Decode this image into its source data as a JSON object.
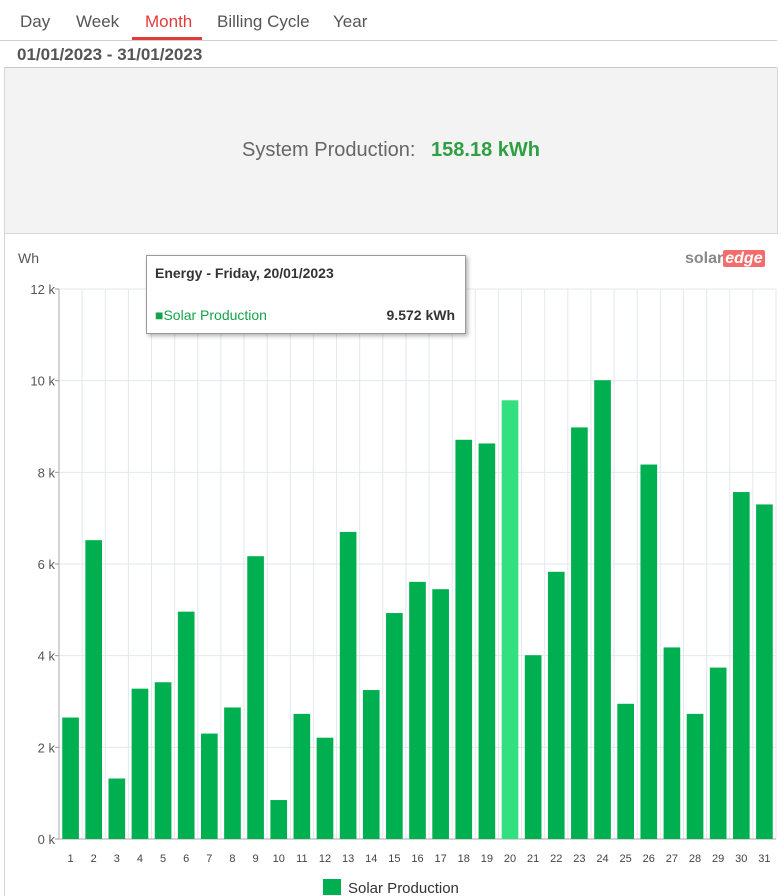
{
  "tabs": [
    {
      "label": "Day"
    },
    {
      "label": "Week"
    },
    {
      "label": "Month"
    },
    {
      "label": "Billing Cycle"
    },
    {
      "label": "Year"
    }
  ],
  "active_tab": "Month",
  "date_range": "01/01/2023 - 31/01/2023",
  "summary": {
    "label": "System Production:",
    "value": "158.18 kWh"
  },
  "logo": {
    "part1": "solar",
    "part2": "edge"
  },
  "tooltip": {
    "title": "Energy - Friday, 20/01/2023",
    "marker": "■",
    "series": "Solar Production",
    "value": "9.572 kWh"
  },
  "colors": {
    "bar": "#00b050",
    "highlight": "#33e080",
    "accent": "#e23b3b",
    "value_green": "#2ea043"
  },
  "chart_data": {
    "type": "bar",
    "ylabel": "Wh",
    "yticks": [
      "0 k",
      "2 k",
      "4 k",
      "6 k",
      "8 k",
      "10 k",
      "12 k"
    ],
    "ylim": [
      0,
      12000
    ],
    "categories": [
      "1",
      "2",
      "3",
      "4",
      "5",
      "6",
      "7",
      "8",
      "9",
      "10",
      "11",
      "12",
      "13",
      "14",
      "15",
      "16",
      "17",
      "18",
      "19",
      "20",
      "21",
      "22",
      "23",
      "24",
      "25",
      "26",
      "27",
      "28",
      "29",
      "30",
      "31"
    ],
    "series": [
      {
        "name": "Solar Production",
        "values": [
          2650,
          6520,
          1320,
          3280,
          3420,
          4960,
          2300,
          2870,
          6170,
          850,
          2730,
          2210,
          6700,
          3250,
          4930,
          5610,
          5450,
          8710,
          8630,
          9572,
          4010,
          5830,
          8980,
          10010,
          2950,
          8170,
          4180,
          2730,
          3740,
          7570,
          7300
        ]
      }
    ],
    "highlight_index": 19,
    "legend": "bottom"
  }
}
